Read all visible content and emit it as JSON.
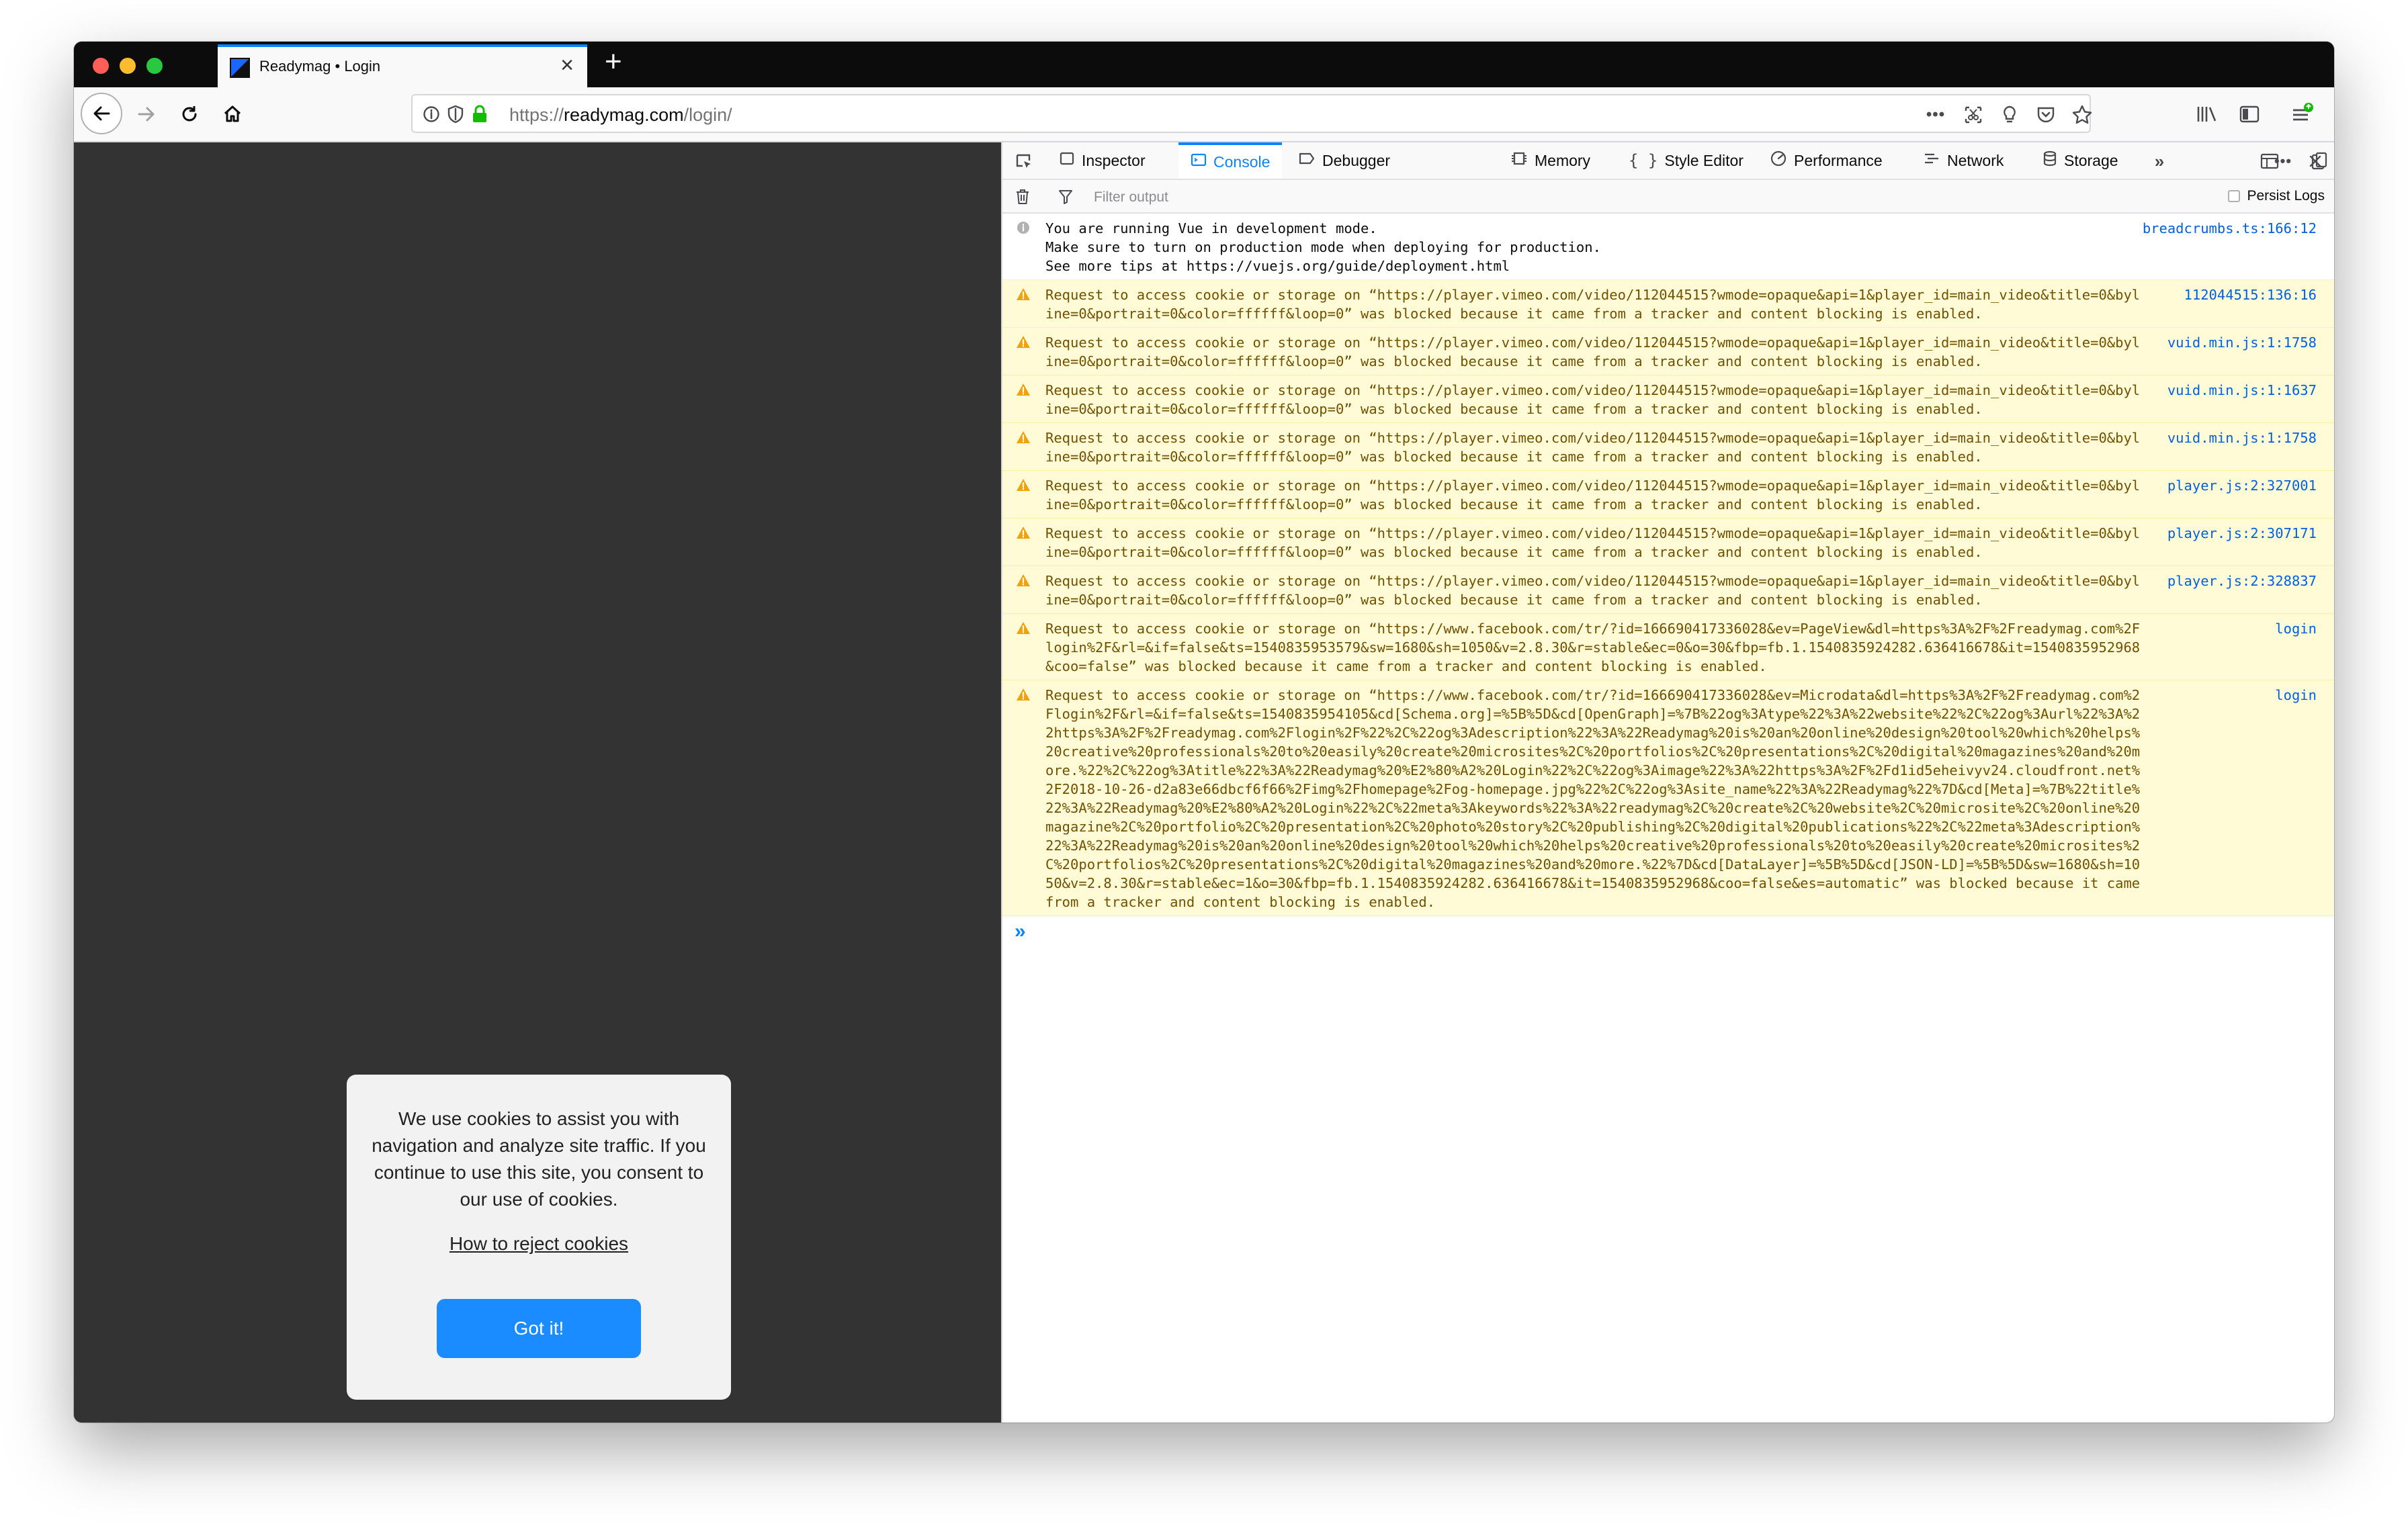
{
  "browser": {
    "tab_title": "Readymag • Login",
    "tab_close": "×",
    "new_tab": "+",
    "url_scheme": "https://",
    "url_host": "readymag.com",
    "url_path": "/login/",
    "url_more": "•••"
  },
  "cookie_banner": {
    "text": "We use cookies to assist you with navigation and analyze site traffic. If you continue to use this site, you consent to our use of cookies.",
    "link": "How to reject cookies",
    "button": "Got it!"
  },
  "devtools": {
    "tabs": [
      {
        "label": "Inspector",
        "icon": "inspector-icon"
      },
      {
        "label": "Console",
        "icon": "console-icon"
      },
      {
        "label": "Debugger",
        "icon": "debugger-icon"
      },
      {
        "label": "Memory",
        "icon": "memory-icon"
      },
      {
        "label": "Style Editor",
        "icon": "style-editor-icon"
      },
      {
        "label": "Performance",
        "icon": "performance-icon"
      },
      {
        "label": "Network",
        "icon": "network-icon"
      },
      {
        "label": "Storage",
        "icon": "storage-icon"
      }
    ],
    "active_tab": "Console",
    "filter_placeholder": "Filter output",
    "persist_logs": "Persist Logs",
    "messages": [
      {
        "level": "info",
        "text": "You are running Vue in development mode.\nMake sure to turn on production mode when deploying for production.\nSee more tips at https://vuejs.org/guide/deployment.html",
        "source": "breadcrumbs.ts:166:12"
      },
      {
        "level": "warn",
        "text": "Request to access cookie or storage on “https://player.vimeo.com/video/112044515?wmode=opaque&api=1&player_id=main_video&title=0&byline=0&portrait=0&color=ffffff&loop=0” was blocked because it came from a tracker and content blocking is enabled.",
        "source": "112044515:136:16"
      },
      {
        "level": "warn",
        "text": "Request to access cookie or storage on “https://player.vimeo.com/video/112044515?wmode=opaque&api=1&player_id=main_video&title=0&byline=0&portrait=0&color=ffffff&loop=0” was blocked because it came from a tracker and content blocking is enabled.",
        "source": "vuid.min.js:1:1758"
      },
      {
        "level": "warn",
        "text": "Request to access cookie or storage on “https://player.vimeo.com/video/112044515?wmode=opaque&api=1&player_id=main_video&title=0&byline=0&portrait=0&color=ffffff&loop=0” was blocked because it came from a tracker and content blocking is enabled.",
        "source": "vuid.min.js:1:1637"
      },
      {
        "level": "warn",
        "text": "Request to access cookie or storage on “https://player.vimeo.com/video/112044515?wmode=opaque&api=1&player_id=main_video&title=0&byline=0&portrait=0&color=ffffff&loop=0” was blocked because it came from a tracker and content blocking is enabled.",
        "source": "vuid.min.js:1:1758"
      },
      {
        "level": "warn",
        "text": "Request to access cookie or storage on “https://player.vimeo.com/video/112044515?wmode=opaque&api=1&player_id=main_video&title=0&byline=0&portrait=0&color=ffffff&loop=0” was blocked because it came from a tracker and content blocking is enabled.",
        "source": "player.js:2:327001"
      },
      {
        "level": "warn",
        "text": "Request to access cookie or storage on “https://player.vimeo.com/video/112044515?wmode=opaque&api=1&player_id=main_video&title=0&byline=0&portrait=0&color=ffffff&loop=0” was blocked because it came from a tracker and content blocking is enabled.",
        "source": "player.js:2:307171"
      },
      {
        "level": "warn",
        "text": "Request to access cookie or storage on “https://player.vimeo.com/video/112044515?wmode=opaque&api=1&player_id=main_video&title=0&byline=0&portrait=0&color=ffffff&loop=0” was blocked because it came from a tracker and content blocking is enabled.",
        "source": "player.js:2:328837"
      },
      {
        "level": "warn",
        "text": "Request to access cookie or storage on “https://www.facebook.com/tr/?id=166690417336028&ev=PageView&dl=https%3A%2F%2Freadymag.com%2Flogin%2F&rl=&if=false&ts=1540835953579&sw=1680&sh=1050&v=2.8.30&r=stable&ec=0&o=30&fbp=fb.1.1540835924282.636416678&it=1540835952968&coo=false” was blocked because it came from a tracker and content blocking is enabled.",
        "source": "login"
      },
      {
        "level": "warn",
        "text": "Request to access cookie or storage on “https://www.facebook.com/tr/?id=166690417336028&ev=Microdata&dl=https%3A%2F%2Freadymag.com%2Flogin%2F&rl=&if=false&ts=1540835954105&cd[Schema.org]=%5B%5D&cd[OpenGraph]=%7B%22og%3Atype%22%3A%22website%22%2C%22og%3Aurl%22%3A%22https%3A%2F%2Freadymag.com%2Flogin%2F%22%2C%22og%3Adescription%22%3A%22Readymag%20is%20an%20online%20design%20tool%20which%20helps%20creative%20professionals%20to%20easily%20create%20microsites%2C%20portfolios%2C%20presentations%2C%20digital%20magazines%20and%20more.%22%2C%22og%3Atitle%22%3A%22Readymag%20%E2%80%A2%20Login%22%2C%22og%3Aimage%22%3A%22https%3A%2F%2Fd1id5eheivyv24.cloudfront.net%2F2018-10-26-d2a83e66dbcf6f66%2Fimg%2Fhomepage%2Fog-homepage.jpg%22%2C%22og%3Asite_name%22%3A%22Readymag%22%7D&cd[Meta]=%7B%22title%22%3A%22Readymag%20%E2%80%A2%20Login%22%2C%22meta%3Akeywords%22%3A%22readymag%2C%20create%2C%20website%2C%20microsite%2C%20online%20magazine%2C%20portfolio%2C%20presentation%2C%20photo%20story%2C%20publishing%2C%20digital%20publications%22%2C%22meta%3Adescription%22%3A%22Readymag%20is%20an%20online%20design%20tool%20which%20helps%20creative%20professionals%20to%20easily%20create%20microsites%2C%20portfolios%2C%20presentations%2C%20digital%20magazines%20and%20more.%22%7D&cd[DataLayer]=%5B%5D&cd[JSON-LD]=%5B%5D&sw=1680&sh=1050&v=2.8.30&r=stable&ec=1&o=30&fbp=fb.1.1540835924282.636416678&it=1540835952968&coo=false&es=automatic” was blocked because it came from a tracker and content blocking is enabled.",
        "source": "login"
      }
    ],
    "prompt": "»"
  }
}
